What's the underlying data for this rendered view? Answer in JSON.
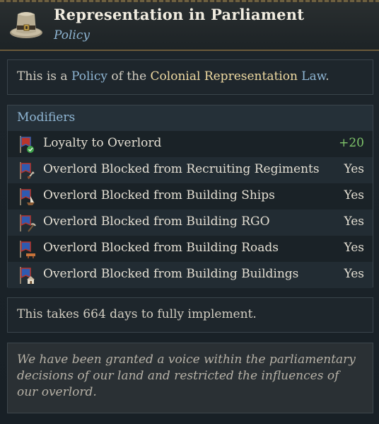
{
  "header": {
    "title": "Representation in Parliament",
    "subtitle": "Policy"
  },
  "description": {
    "prefix": "This is a ",
    "policy_word": "Policy",
    "middle": " of the ",
    "law_name": "Colonial Representation",
    "law_word": " Law",
    "suffix": "."
  },
  "modifiers": {
    "heading": "Modifiers",
    "items": [
      {
        "label": "Loyalty to Overlord",
        "value": "+20",
        "icon": "loyalty-banner-icon"
      },
      {
        "label": "Overlord Blocked from Recruiting Regiments",
        "value": "Yes",
        "icon": "regiment-banner-icon"
      },
      {
        "label": "Overlord Blocked from Building Ships",
        "value": "Yes",
        "icon": "ship-banner-icon"
      },
      {
        "label": "Overlord Blocked from Building RGO",
        "value": "Yes",
        "icon": "rgo-banner-icon"
      },
      {
        "label": "Overlord Blocked from Building Roads",
        "value": "Yes",
        "icon": "road-banner-icon"
      },
      {
        "label": "Overlord Blocked from Building Buildings",
        "value": "Yes",
        "icon": "building-banner-icon"
      }
    ]
  },
  "implementation": {
    "text": "This takes 664 days to fully implement."
  },
  "flavor": {
    "text": "We have been granted a voice within the parliamentary decisions of our land and restricted the influences of our overlord."
  },
  "colors": {
    "accent_blue": "#8fb6d4",
    "gold": "#f0dba2",
    "positive_green": "#7fc46a"
  }
}
